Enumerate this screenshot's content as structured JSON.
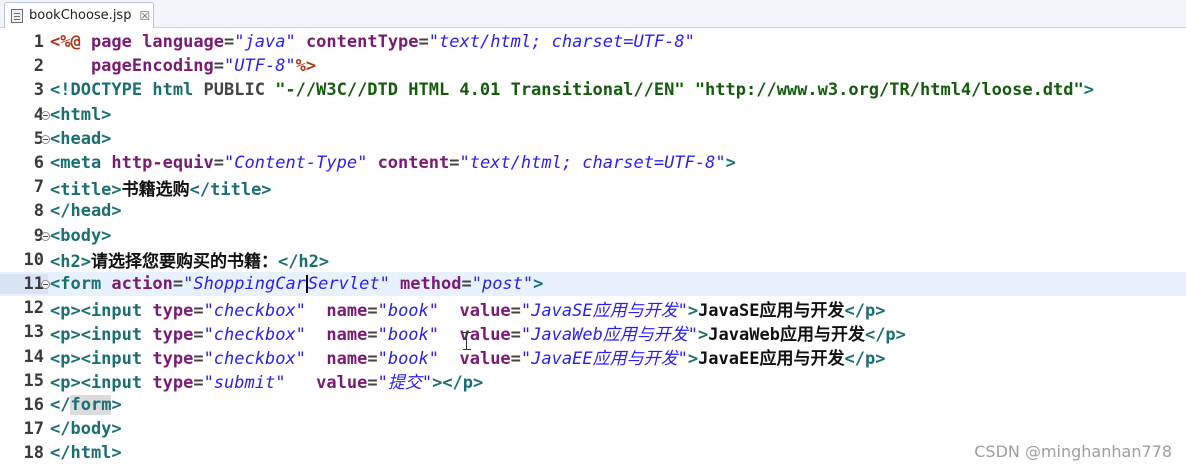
{
  "tab": {
    "label": "bookChoose.jsp",
    "close_glyph": "☒"
  },
  "watermark": "CSDN @minghanhan778",
  "current_line": 11,
  "lines": [
    {
      "n": "1",
      "fold": false,
      "tokens": [
        {
          "c": "dir",
          "t": "<%@ "
        },
        {
          "c": "attr",
          "t": "page "
        },
        {
          "c": "attr",
          "t": "language"
        },
        {
          "c": "plain",
          "t": "="
        },
        {
          "c": "str",
          "t": "\"java\""
        },
        {
          "c": "attr",
          "t": " contentType"
        },
        {
          "c": "plain",
          "t": "="
        },
        {
          "c": "str",
          "t": "\"text/html; charset=UTF-8\""
        }
      ]
    },
    {
      "n": "2",
      "fold": false,
      "tokens": [
        {
          "c": "attr",
          "t": "    pageEncoding"
        },
        {
          "c": "plain",
          "t": "="
        },
        {
          "c": "str",
          "t": "\"UTF-8\""
        },
        {
          "c": "dir",
          "t": "%>"
        }
      ]
    },
    {
      "n": "3",
      "fold": false,
      "tokens": [
        {
          "c": "doc",
          "t": "<!DOCTYPE html "
        },
        {
          "c": "plain",
          "t": "PUBLIC "
        },
        {
          "c": "docstr",
          "t": "\"-//W3C//DTD HTML 4.01 Transitional//EN\" \"http://www.w3.org/TR/html4/loose.dtd\""
        },
        {
          "c": "doc",
          "t": ">"
        }
      ]
    },
    {
      "n": "4",
      "fold": true,
      "tokens": [
        {
          "c": "tag",
          "t": "<html>"
        }
      ]
    },
    {
      "n": "5",
      "fold": true,
      "tokens": [
        {
          "c": "tag",
          "t": "<head>"
        }
      ]
    },
    {
      "n": "6",
      "fold": false,
      "tokens": [
        {
          "c": "tag",
          "t": "<meta "
        },
        {
          "c": "attr",
          "t": "http-equiv"
        },
        {
          "c": "plain",
          "t": "="
        },
        {
          "c": "str",
          "t": "\"Content-Type\""
        },
        {
          "c": "attr",
          "t": " content"
        },
        {
          "c": "plain",
          "t": "="
        },
        {
          "c": "str",
          "t": "\"text/html; charset=UTF-8\""
        },
        {
          "c": "tag",
          "t": ">"
        }
      ]
    },
    {
      "n": "7",
      "fold": false,
      "tokens": [
        {
          "c": "tag",
          "t": "<title>"
        },
        {
          "c": "text",
          "t": "书籍选购"
        },
        {
          "c": "tag",
          "t": "</title>"
        }
      ]
    },
    {
      "n": "8",
      "fold": false,
      "tokens": [
        {
          "c": "tag",
          "t": "</head>"
        }
      ]
    },
    {
      "n": "9",
      "fold": true,
      "tokens": [
        {
          "c": "tag",
          "t": "<body>"
        }
      ]
    },
    {
      "n": "10",
      "fold": false,
      "tokens": [
        {
          "c": "tag",
          "t": "<h2>"
        },
        {
          "c": "text",
          "t": "请选择您要购买的书籍："
        },
        {
          "c": "tag",
          "t": "</h2>"
        }
      ]
    },
    {
      "n": "11",
      "fold": true,
      "tokens": [
        {
          "c": "tag",
          "t": "<form "
        },
        {
          "c": "attr",
          "t": "action"
        },
        {
          "c": "plain",
          "t": "="
        },
        {
          "c": "str",
          "t": "\"ShoppingCar"
        },
        {
          "c": "caret",
          "t": ""
        },
        {
          "c": "str",
          "t": "Servlet\""
        },
        {
          "c": "attr",
          "t": " method"
        },
        {
          "c": "plain",
          "t": "="
        },
        {
          "c": "str",
          "t": "\"post\""
        },
        {
          "c": "tag",
          "t": ">"
        }
      ]
    },
    {
      "n": "12",
      "fold": false,
      "tokens": [
        {
          "c": "tag",
          "t": "<p><input "
        },
        {
          "c": "attr",
          "t": "type"
        },
        {
          "c": "plain",
          "t": "="
        },
        {
          "c": "str",
          "t": "\"checkbox\""
        },
        {
          "c": "attr",
          "t": "  name"
        },
        {
          "c": "plain",
          "t": "="
        },
        {
          "c": "str",
          "t": "\"book\""
        },
        {
          "c": "attr",
          "t": "  value"
        },
        {
          "c": "plain",
          "t": "="
        },
        {
          "c": "str",
          "t": "\"JavaSE应用与开发\""
        },
        {
          "c": "tag",
          "t": ">"
        },
        {
          "c": "text",
          "t": "JavaSE应用与开发"
        },
        {
          "c": "tag",
          "t": "</p>"
        }
      ]
    },
    {
      "n": "13",
      "fold": false,
      "tokens": [
        {
          "c": "tag",
          "t": "<p><input "
        },
        {
          "c": "attr",
          "t": "type"
        },
        {
          "c": "plain",
          "t": "="
        },
        {
          "c": "str",
          "t": "\"checkbox\""
        },
        {
          "c": "attr",
          "t": "  name"
        },
        {
          "c": "plain",
          "t": "="
        },
        {
          "c": "str",
          "t": "\"book\""
        },
        {
          "c": "attr",
          "t": "  value"
        },
        {
          "c": "plain",
          "t": "="
        },
        {
          "c": "str",
          "t": "\"JavaWeb应用与开发\""
        },
        {
          "c": "tag",
          "t": ">"
        },
        {
          "c": "text",
          "t": "JavaWeb应用与开发"
        },
        {
          "c": "tag",
          "t": "</p>"
        }
      ]
    },
    {
      "n": "14",
      "fold": false,
      "tokens": [
        {
          "c": "tag",
          "t": "<p><input "
        },
        {
          "c": "attr",
          "t": "type"
        },
        {
          "c": "plain",
          "t": "="
        },
        {
          "c": "str",
          "t": "\"checkbox\""
        },
        {
          "c": "attr",
          "t": "  name"
        },
        {
          "c": "plain",
          "t": "="
        },
        {
          "c": "str",
          "t": "\"book\""
        },
        {
          "c": "attr",
          "t": "  value"
        },
        {
          "c": "plain",
          "t": "="
        },
        {
          "c": "str",
          "t": "\"JavaEE应用与开发\""
        },
        {
          "c": "tag",
          "t": ">"
        },
        {
          "c": "text",
          "t": "JavaEE应用与开发"
        },
        {
          "c": "tag",
          "t": "</p>"
        }
      ]
    },
    {
      "n": "15",
      "fold": false,
      "tokens": [
        {
          "c": "tag",
          "t": "<p><input "
        },
        {
          "c": "attr",
          "t": "type"
        },
        {
          "c": "plain",
          "t": "="
        },
        {
          "c": "str",
          "t": "\"submit\""
        },
        {
          "c": "attr",
          "t": "   value"
        },
        {
          "c": "plain",
          "t": "="
        },
        {
          "c": "str",
          "t": "\"提交\""
        },
        {
          "c": "tag",
          "t": "></p>"
        }
      ]
    },
    {
      "n": "16",
      "fold": false,
      "tokens": [
        {
          "c": "tag",
          "t": "</"
        },
        {
          "c": "tag hl",
          "t": "form"
        },
        {
          "c": "tag",
          "t": ">"
        }
      ]
    },
    {
      "n": "17",
      "fold": false,
      "tokens": [
        {
          "c": "tag",
          "t": "</body>"
        }
      ]
    },
    {
      "n": "18",
      "fold": false,
      "tokens": [
        {
          "c": "tag",
          "t": "</html>"
        }
      ]
    }
  ]
}
